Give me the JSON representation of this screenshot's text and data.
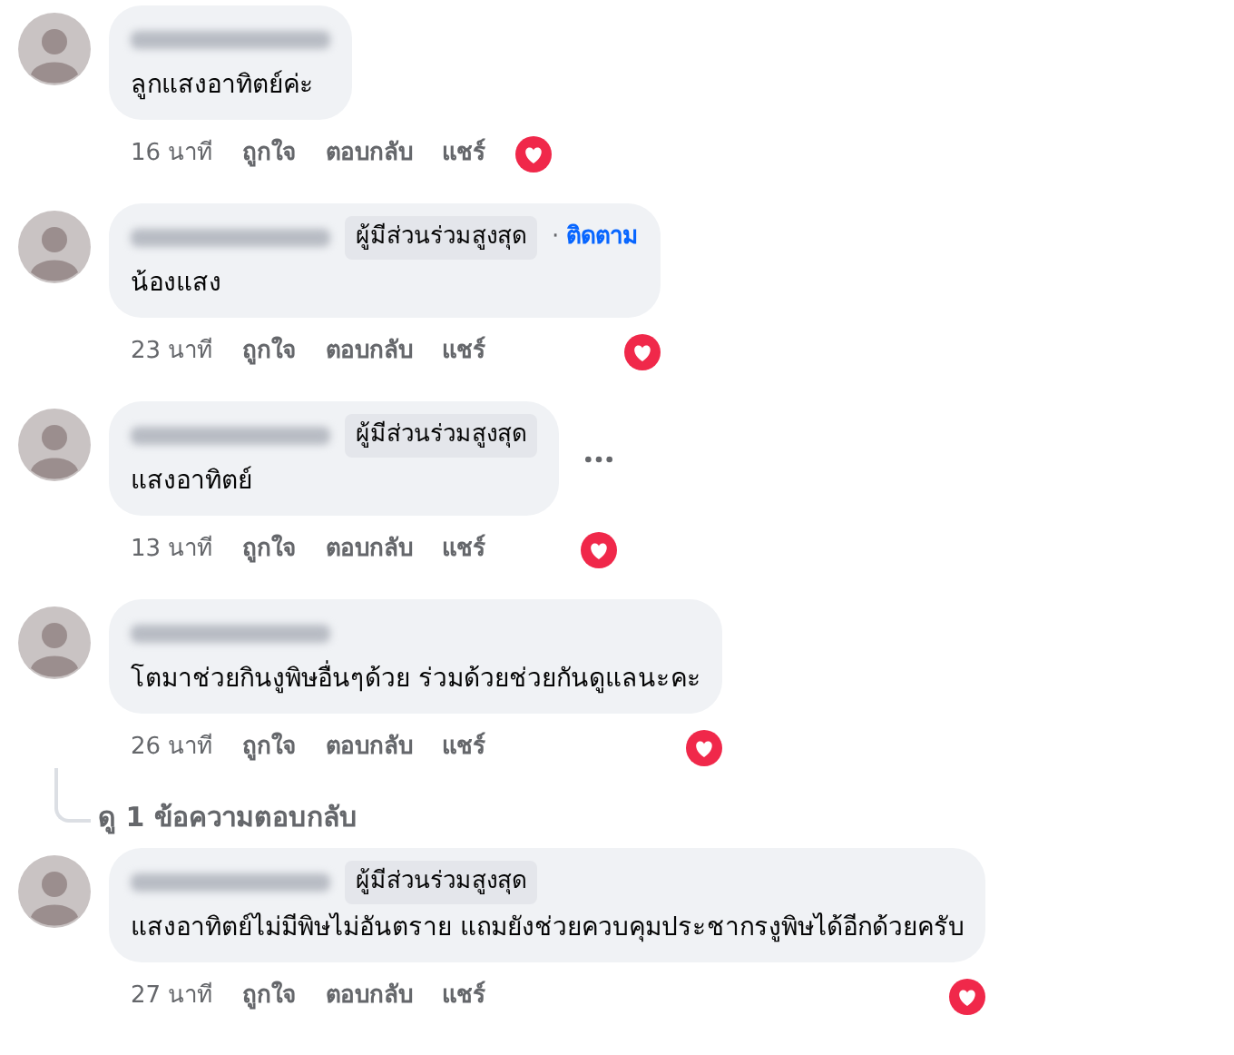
{
  "comments": [
    {
      "text": "ลูกแสงอาทิตย์ค่ะ",
      "menu": false,
      "time": "16 นาที",
      "actions": [
        "ถูกใจ",
        "ตอบกลับ",
        "แชร์"
      ]
    },
    {
      "badge": "ผู้มีส่วนร่วมสูงสุด",
      "separator": "·",
      "follow": "ติดตาม",
      "text": "น้องแสง",
      "menu": false,
      "time": "23 นาที",
      "actions": [
        "ถูกใจ",
        "ตอบกลับ",
        "แชร์"
      ]
    },
    {
      "badge": "ผู้มีส่วนร่วมสูงสุด",
      "text": "แสงอาทิตย์",
      "menu": true,
      "time": "13 นาที",
      "actions": [
        "ถูกใจ",
        "ตอบกลับ",
        "แชร์"
      ]
    },
    {
      "text": "โตมาช่วยกินงูพิษอื่นๆด้วย ร่วมด้วยช่วยกันดูแลนะคะ",
      "menu": false,
      "time": "26 นาที",
      "actions": [
        "ถูกใจ",
        "ตอบกลับ",
        "แชร์"
      ],
      "replies_link": "ดู 1 ข้อความตอบกลับ"
    },
    {
      "badge": "ผู้มีส่วนร่วมสูงสุด",
      "text": "แสงอาทิตย์ไม่มีพิษไม่อันตราย แถมยังช่วยควบคุมประชากรงูพิษได้อีกด้วยครับ",
      "menu": false,
      "time": "27 นาที",
      "actions": [
        "ถูกใจ",
        "ตอบกลับ",
        "แชร์"
      ]
    }
  ]
}
